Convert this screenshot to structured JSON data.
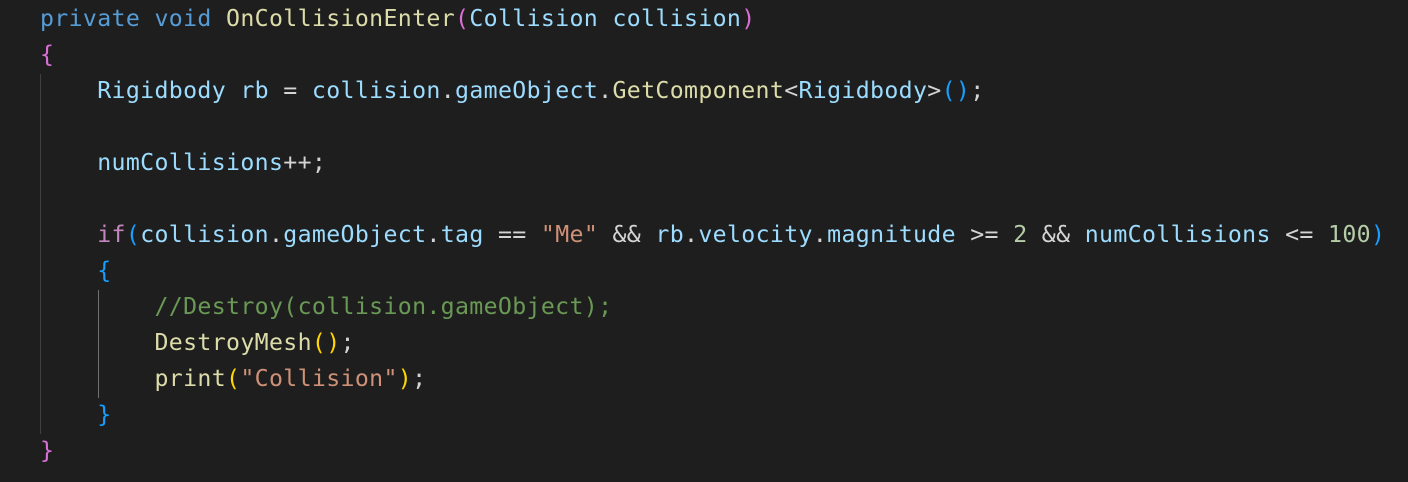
{
  "editor": {
    "lines": [
      {
        "indent": 0,
        "tokens": [
          {
            "t": "private",
            "c": "kw"
          },
          {
            "t": " ",
            "c": "op"
          },
          {
            "t": "void",
            "c": "kw"
          },
          {
            "t": " ",
            "c": "op"
          },
          {
            "t": "OnCollisionEnter",
            "c": "fn"
          },
          {
            "t": "(",
            "c": "b1"
          },
          {
            "t": "Collision",
            "c": "var"
          },
          {
            "t": " ",
            "c": "op"
          },
          {
            "t": "collision",
            "c": "var"
          },
          {
            "t": ")",
            "c": "b1"
          }
        ]
      },
      {
        "indent": 0,
        "tokens": [
          {
            "t": "{",
            "c": "b1"
          }
        ]
      },
      {
        "indent": 4,
        "tokens": [
          {
            "t": "Rigidbody",
            "c": "var"
          },
          {
            "t": " ",
            "c": "op"
          },
          {
            "t": "rb",
            "c": "var"
          },
          {
            "t": " = ",
            "c": "op"
          },
          {
            "t": "collision",
            "c": "var"
          },
          {
            "t": ".",
            "c": "op"
          },
          {
            "t": "gameObject",
            "c": "var"
          },
          {
            "t": ".",
            "c": "op"
          },
          {
            "t": "GetComponent",
            "c": "fn"
          },
          {
            "t": "<",
            "c": "op"
          },
          {
            "t": "Rigidbody",
            "c": "var"
          },
          {
            "t": ">",
            "c": "op"
          },
          {
            "t": "()",
            "c": "b2"
          },
          {
            "t": ";",
            "c": "op"
          }
        ]
      },
      {
        "indent": 0,
        "tokens": []
      },
      {
        "indent": 4,
        "tokens": [
          {
            "t": "numCollisions",
            "c": "var"
          },
          {
            "t": "++;",
            "c": "op"
          }
        ]
      },
      {
        "indent": 0,
        "tokens": []
      },
      {
        "indent": 4,
        "tokens": [
          {
            "t": "if",
            "c": "ctl"
          },
          {
            "t": "(",
            "c": "b2"
          },
          {
            "t": "collision",
            "c": "var"
          },
          {
            "t": ".",
            "c": "op"
          },
          {
            "t": "gameObject",
            "c": "var"
          },
          {
            "t": ".",
            "c": "op"
          },
          {
            "t": "tag",
            "c": "var"
          },
          {
            "t": " == ",
            "c": "op"
          },
          {
            "t": "\"Me\"",
            "c": "str"
          },
          {
            "t": " && ",
            "c": "op"
          },
          {
            "t": "rb",
            "c": "var"
          },
          {
            "t": ".",
            "c": "op"
          },
          {
            "t": "velocity",
            "c": "var"
          },
          {
            "t": ".",
            "c": "op"
          },
          {
            "t": "magnitude",
            "c": "var"
          },
          {
            "t": " >= ",
            "c": "op"
          },
          {
            "t": "2",
            "c": "num"
          },
          {
            "t": " && ",
            "c": "op"
          },
          {
            "t": "numCollisions",
            "c": "var"
          },
          {
            "t": " <= ",
            "c": "op"
          },
          {
            "t": "100",
            "c": "num"
          },
          {
            "t": ")",
            "c": "b2"
          }
        ]
      },
      {
        "indent": 4,
        "tokens": [
          {
            "t": "{",
            "c": "b2"
          }
        ]
      },
      {
        "indent": 8,
        "tokens": [
          {
            "t": "//Destroy(collision.gameObject);",
            "c": "cmt"
          }
        ]
      },
      {
        "indent": 8,
        "tokens": [
          {
            "t": "DestroyMesh",
            "c": "fn"
          },
          {
            "t": "()",
            "c": "b3"
          },
          {
            "t": ";",
            "c": "op"
          }
        ]
      },
      {
        "indent": 8,
        "tokens": [
          {
            "t": "print",
            "c": "fn"
          },
          {
            "t": "(",
            "c": "b3"
          },
          {
            "t": "\"Collision\"",
            "c": "str"
          },
          {
            "t": ")",
            "c": "b3"
          },
          {
            "t": ";",
            "c": "op"
          }
        ]
      },
      {
        "indent": 4,
        "tokens": [
          {
            "t": "}",
            "c": "b2"
          }
        ]
      },
      {
        "indent": 0,
        "tokens": [
          {
            "t": "}",
            "c": "b1"
          }
        ]
      }
    ]
  },
  "theme": {
    "background": "#1e1e1e",
    "keyword": "#569cd6",
    "control": "#c586c0",
    "function": "#dcdcaa",
    "variable": "#9cdcfe",
    "string": "#ce9178",
    "number": "#b5cea8",
    "comment": "#6a9955",
    "bracket_1": "#da70d6",
    "bracket_2": "#179fff",
    "bracket_3": "#ffd700"
  }
}
